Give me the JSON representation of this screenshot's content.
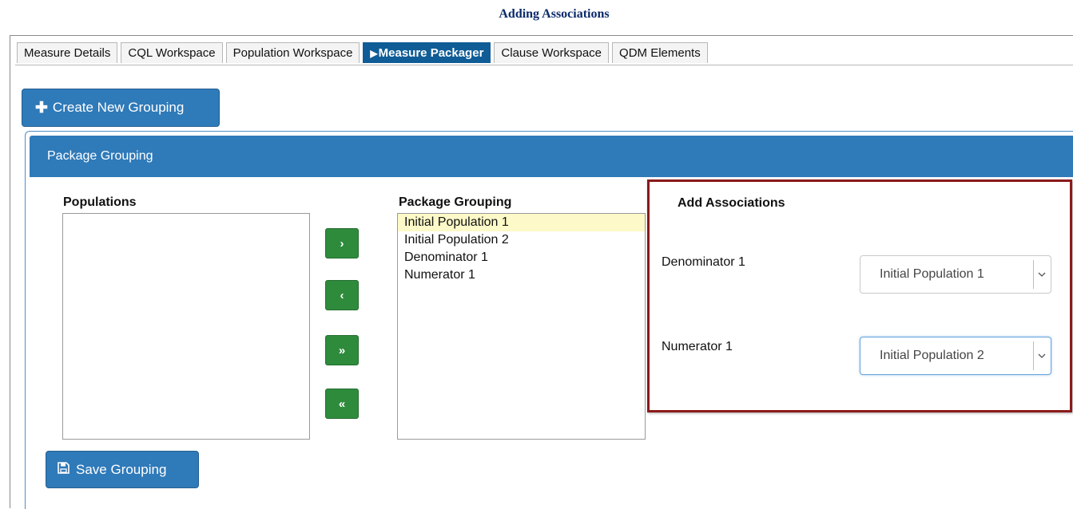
{
  "doc_title": "Adding Associations",
  "tabs": [
    {
      "label": "Measure Details",
      "active": false
    },
    {
      "label": "CQL Workspace",
      "active": false
    },
    {
      "label": "Population Workspace",
      "active": false
    },
    {
      "label": "Measure Packager",
      "active": true
    },
    {
      "label": "Clause Workspace",
      "active": false
    },
    {
      "label": "QDM Elements",
      "active": false
    }
  ],
  "create_button": {
    "label": "Create New Grouping",
    "icon": "plus-icon"
  },
  "panel": {
    "title": "Package Grouping"
  },
  "populations": {
    "label": "Populations",
    "items": []
  },
  "package_grouping": {
    "label": "Package Grouping",
    "items": [
      "Initial Population 1",
      "Initial Population 2",
      "Denominator 1",
      "Numerator 1"
    ],
    "selected_index": 0
  },
  "move_buttons": {
    "add": "›",
    "remove": "‹",
    "add_all": "»",
    "remove_all": "«"
  },
  "associations": {
    "title": "Add Associations",
    "rows": [
      {
        "label": "Denominator 1",
        "value": "Initial Population 1"
      },
      {
        "label": "Numerator 1",
        "value": "Initial Population 2"
      }
    ]
  },
  "save_button": {
    "label": "Save Grouping",
    "icon": "save-icon"
  },
  "colors": {
    "primary": "#2f7ab9",
    "active_tab": "#0f5c96",
    "move": "#2e8b3c",
    "highlight_border": "#8b1a1a",
    "selected_item": "#fdf9c8"
  }
}
